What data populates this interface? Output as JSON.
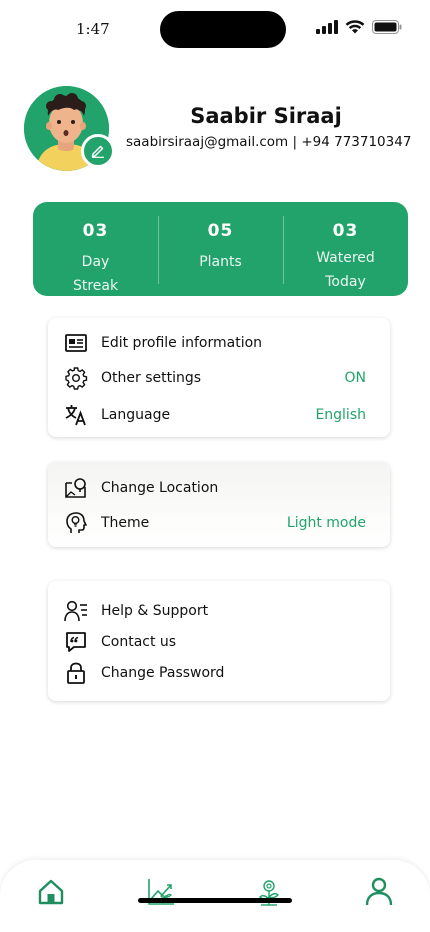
{
  "status_bar": {
    "time": "1:47"
  },
  "profile": {
    "name": "Saabir Siraaj",
    "contact": "saabirsiraaj@gmail.com | +94 773710347"
  },
  "stats": [
    {
      "value": "03",
      "label_line1": "Day",
      "label_line2": "Streak"
    },
    {
      "value": "05",
      "label_line1": "Plants",
      "label_line2": ""
    },
    {
      "value": "03",
      "label_line1": "Watered",
      "label_line2": "Today"
    }
  ],
  "settings_card": {
    "edit_profile": "Edit profile information",
    "other_settings": "Other settings",
    "other_settings_value": "ON",
    "language": "Language",
    "language_value": "English"
  },
  "location_card": {
    "change_location": "Change Location",
    "theme": "Theme",
    "theme_value": "Light mode"
  },
  "support_card": {
    "help_support": "Help & Support",
    "contact_us": "Contact us",
    "change_password": "Change Password"
  },
  "bottom_nav": {
    "items": [
      "home-icon",
      "growth-chart-icon",
      "plant-icon",
      "profile-icon"
    ],
    "active_index": 0
  },
  "colors": {
    "accent": "#22a36b",
    "text": "#111111",
    "card_bg": "#ffffff"
  }
}
